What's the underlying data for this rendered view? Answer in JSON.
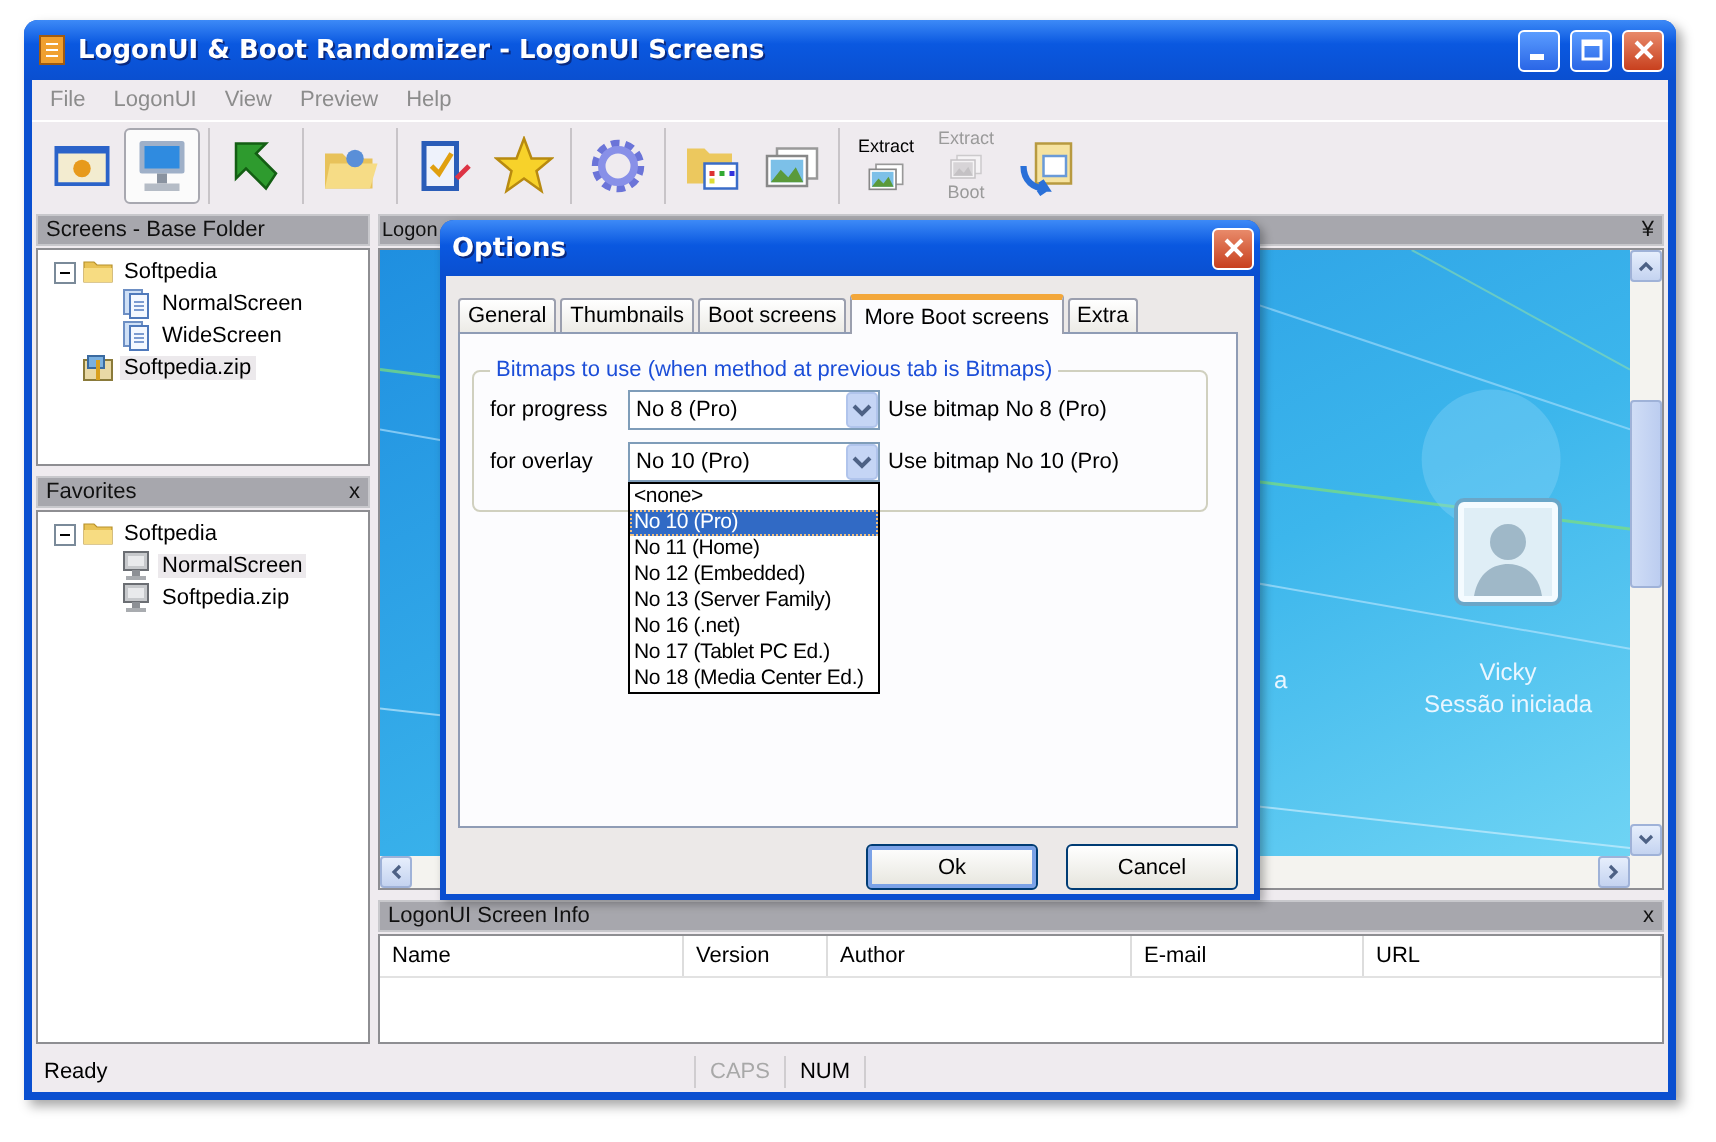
{
  "window": {
    "title": "LogonUI & Boot Randomizer - LogonUI Screens"
  },
  "menu": [
    {
      "label": "File"
    },
    {
      "label": "LogonUI"
    },
    {
      "label": "View"
    },
    {
      "label": "Preview"
    },
    {
      "label": "Help"
    }
  ],
  "toolbar_groups": [
    {
      "buttons": [
        {
          "kind": "window",
          "selected": false,
          "disabled": false
        },
        {
          "kind": "monitor",
          "selected": true,
          "disabled": false
        }
      ]
    },
    {
      "buttons": [
        {
          "kind": "arrow",
          "selected": false,
          "disabled": false
        }
      ]
    },
    {
      "buttons": [
        {
          "kind": "folder-open",
          "selected": false,
          "disabled": false
        }
      ]
    },
    {
      "buttons": [
        {
          "kind": "checklist",
          "selected": false,
          "disabled": false
        },
        {
          "kind": "star",
          "selected": false,
          "disabled": false
        }
      ]
    },
    {
      "buttons": [
        {
          "kind": "gear",
          "selected": false,
          "disabled": false
        }
      ]
    },
    {
      "buttons": [
        {
          "kind": "folder-grid",
          "selected": false,
          "disabled": false
        },
        {
          "kind": "pictures",
          "selected": false,
          "disabled": false
        }
      ]
    },
    {
      "buttons": [
        {
          "kind": "pictures",
          "label": "Extract",
          "selected": false,
          "disabled": false
        },
        {
          "kind": "pictures",
          "label": "Extract",
          "sublabel": "Boot",
          "selected": false,
          "disabled": true
        },
        {
          "kind": "exchange",
          "selected": false,
          "disabled": false
        }
      ]
    }
  ],
  "screens_panel": {
    "title": "Screens - Base Folder",
    "tree": [
      {
        "label": "Softpedia",
        "kind": "folder",
        "selected": false,
        "expanded": true,
        "children": [
          {
            "label": "NormalScreen",
            "kind": "page",
            "selected": false
          },
          {
            "label": "WideScreen",
            "kind": "page",
            "selected": false
          }
        ]
      },
      {
        "label": "Softpedia.zip",
        "kind": "archive",
        "selected": true
      }
    ]
  },
  "favorites_panel": {
    "title": "Favorites",
    "close": "x",
    "tree": [
      {
        "label": "Softpedia",
        "kind": "folder",
        "selected": false,
        "expanded": true,
        "children": [
          {
            "label": "NormalScreen",
            "kind": "monitor",
            "selected": true
          },
          {
            "label": "Softpedia.zip",
            "kind": "monitor",
            "selected": false
          }
        ]
      }
    ]
  },
  "preview_panel": {
    "title": "Logon",
    "pin": "¥",
    "cut_text": "a",
    "user_name": "Vicky",
    "user_status": "Sessão iniciada"
  },
  "info_panel": {
    "title": "LogonUI Screen Info",
    "close": "x",
    "columns": [
      "Name",
      "Version",
      "Author",
      "E-mail",
      "URL"
    ]
  },
  "status_bar": {
    "text": "Ready",
    "indicators": [
      {
        "label": "CAPS",
        "on": false
      },
      {
        "label": "NUM",
        "on": true
      }
    ]
  },
  "dialog": {
    "title": "Options",
    "tabs": [
      {
        "label": "General",
        "selected": false
      },
      {
        "label": "Thumbnails",
        "selected": false
      },
      {
        "label": "Boot screens",
        "selected": false
      },
      {
        "label": "More Boot screens",
        "selected": true
      },
      {
        "label": "Extra",
        "selected": false
      }
    ],
    "group": {
      "title": "Bitmaps to use (when method at previous tab is Bitmaps)",
      "rows": [
        {
          "label": "for progress",
          "value": "No 8 (Pro)",
          "note": "Use bitmap No 8 (Pro)",
          "open": false
        },
        {
          "label": "for overlay",
          "value": "No 10 (Pro)",
          "note": "Use bitmap No 10 (Pro)",
          "open": true,
          "options": [
            {
              "label": "<none>",
              "selected": false
            },
            {
              "label": "No 10 (Pro)",
              "selected": true
            },
            {
              "label": "No 11 (Home)",
              "selected": false
            },
            {
              "label": "No 12 (Embedded)",
              "selected": false
            },
            {
              "label": "No 13 (Server Family)",
              "selected": false
            },
            {
              "label": "No 16 (.net)",
              "selected": false
            },
            {
              "label": "No 17 (Tablet PC Ed.)",
              "selected": false
            },
            {
              "label": "No 18 (Media Center Ed.)",
              "selected": false
            }
          ]
        }
      ]
    },
    "buttons": [
      {
        "label": "Ok",
        "default": true
      },
      {
        "label": "Cancel",
        "default": false
      }
    ]
  }
}
